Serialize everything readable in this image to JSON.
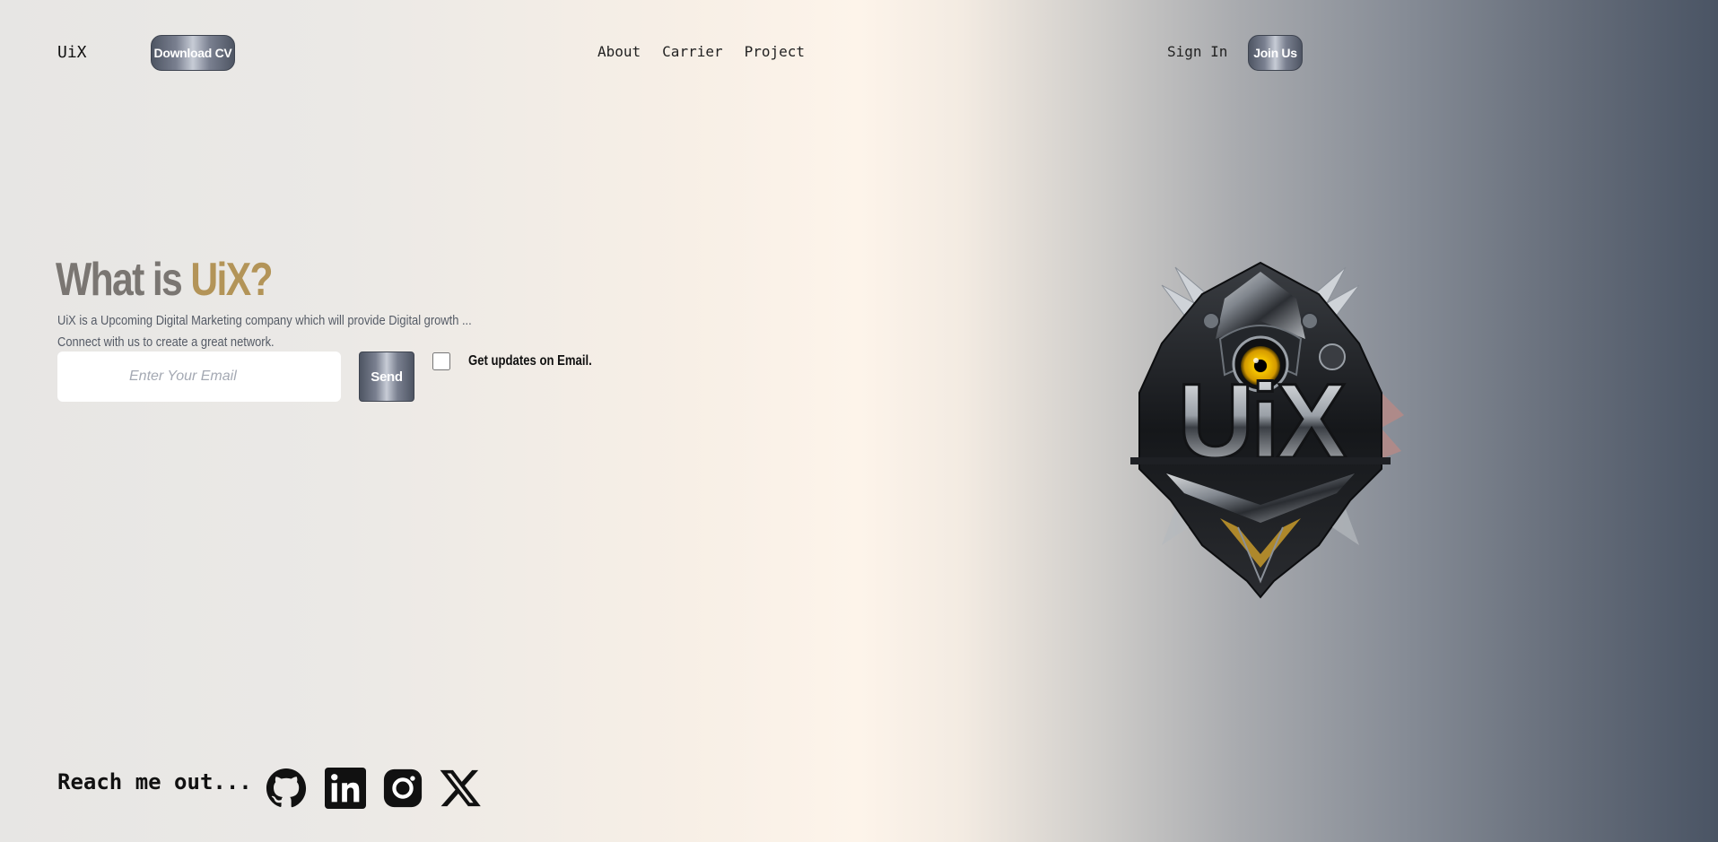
{
  "header": {
    "brand": "UiX",
    "download_label": "Download CV",
    "nav": [
      "About",
      "Carrier",
      "Project"
    ],
    "signin_label": "Sign In",
    "join_label": "Join Us"
  },
  "hero": {
    "title_part1": "What is",
    "title_part2": "UiX?",
    "desc_line1": "UiX is a Upcoming Digital Marketing company which will provide Digital growth ...",
    "desc_line2": "Connect with us to create a great network.",
    "email_placeholder": "Enter Your Email",
    "send_label": "Send",
    "updates_label": "Get updates on Email.",
    "updates_checked": false
  },
  "logo": {
    "text": "UiX",
    "icon": "uix-emblem-icon"
  },
  "footer": {
    "reach_label": "Reach me out...",
    "socials": [
      "github-icon",
      "linkedin-icon",
      "instagram-icon",
      "x-icon"
    ]
  },
  "colors": {
    "title_gray": "#7a7672",
    "title_gold": "#b39458",
    "button_metal": "#4e5563",
    "gradient_right": "#4a5464"
  }
}
